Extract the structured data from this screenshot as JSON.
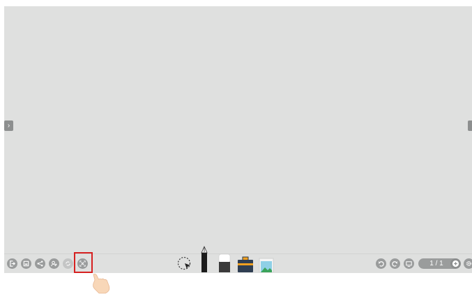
{
  "navigation": {
    "left_arrow": "›",
    "right_arrow": ""
  },
  "toolbar": {
    "left_icons": [
      "exit-icon",
      "save-icon",
      "share-icon",
      "add-user-icon",
      "sync-icon",
      "fullscreen-icon"
    ],
    "center_tools": [
      "lasso-select-icon",
      "pen-icon",
      "eraser-icon",
      "toolbox-icon",
      "image-icon"
    ],
    "right_icons": [
      "undo-icon",
      "redo-icon",
      "display-icon",
      "add-page-icon",
      "settings-icon"
    ],
    "page_indicator": "1 / 1"
  },
  "colors": {
    "canvas": "#dfe0df",
    "icon": "#9a9c9c",
    "highlight": "#d62020"
  }
}
